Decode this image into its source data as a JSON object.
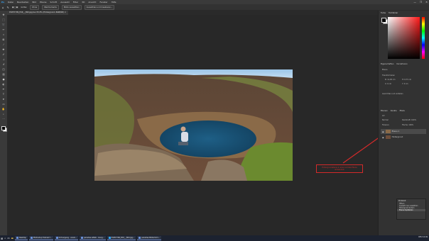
{
  "app": {
    "window_controls": [
      "—",
      "❐",
      "✕"
    ]
  },
  "menu": [
    "Datei",
    "Bearbeiten",
    "Bild",
    "Ebene",
    "Schrift",
    "Auswahl",
    "Filter",
    "3D",
    "Ansicht",
    "Fenster",
    "Hilfe"
  ],
  "options_bar": {
    "size_label": "Größe:",
    "size_value": "Ohne",
    "toggle_label": "Weiche Kante",
    "select_subject": "Motiv auswählen",
    "select_mask": "Auswählen und maskieren..."
  },
  "document_tab": {
    "title": "P1057799_Edit_-_Bild.jpg bei 33,3% (Hintergrund, RGB/8#) ×"
  },
  "right_panel": {
    "top_tabs": [
      "Farbe",
      "Farbfelder"
    ],
    "properties_tabs": [
      "Eigenschaften",
      "Korrekturen"
    ],
    "properties_sub": "Ebene",
    "transform_header": "Transformieren",
    "transform_w": "B: 11,95 cm",
    "transform_h": "H: 6,73 cm",
    "transform_x": "X: 0 cm",
    "transform_y": "Y: 0 cm",
    "align_header": "Ausrichten und verteilen",
    "layers_tabs": [
      "Ebenen",
      "Kanäle",
      "Pfade"
    ],
    "layer_filter": "Art",
    "blend_mode": "Normal",
    "opacity_label": "Deckkraft: 100%",
    "lock_label": "Fixieren:",
    "fill_label": "Fläche: 100%",
    "layers": [
      {
        "name": "Ebene 1",
        "selected": true
      },
      {
        "name": "Hintergrund",
        "selected": false
      }
    ],
    "history_header": "Protokoll",
    "history_items": [
      "Öffnen",
      "Auswahl neu auswählen",
      "Hintergrund ändern",
      "Ebene duplizieren"
    ]
  },
  "annotation": {
    "text": "Hintergrundebene in eine normale Ebene umwandeln",
    "color": "#d42a2a"
  },
  "taskbar": {
    "items": [
      "Desktop",
      "Photoshop Tutorial f...",
      "Ordnergang - analo...",
      "paradise alfalb - Goog...",
      "P1057799_Edit_-_Bild.jpg...",
      "paradise Bildschirm..."
    ],
    "tray_text": "DEU  12:49"
  }
}
